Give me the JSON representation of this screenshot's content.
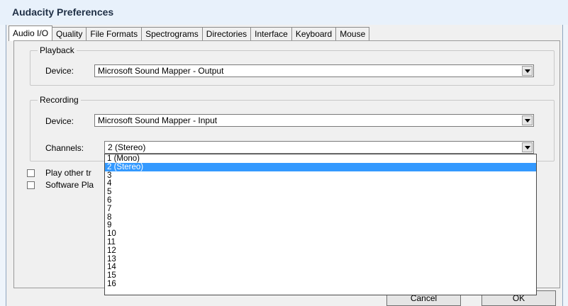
{
  "window": {
    "title": "Audacity Preferences"
  },
  "tabs": [
    {
      "label": "Audio I/O",
      "active": true
    },
    {
      "label": "Quality"
    },
    {
      "label": "File Formats"
    },
    {
      "label": "Spectrograms"
    },
    {
      "label": "Directories"
    },
    {
      "label": "Interface"
    },
    {
      "label": "Keyboard"
    },
    {
      "label": "Mouse"
    }
  ],
  "playback": {
    "legend": "Playback",
    "device_label": "Device:",
    "device_value": "Microsoft Sound Mapper - Output"
  },
  "recording": {
    "legend": "Recording",
    "device_label": "Device:",
    "device_value": "Microsoft Sound Mapper - Input",
    "channels_label": "Channels:",
    "channels_value": "2 (Stereo)"
  },
  "checkboxes": [
    {
      "label": "Play other tr",
      "checked": false
    },
    {
      "label": "Software Pla",
      "checked": false
    }
  ],
  "channels_dropdown": {
    "options": [
      "1 (Mono)",
      "2 (Stereo)",
      "3",
      "4",
      "5",
      "6",
      "7",
      "8",
      "9",
      "10",
      "11",
      "12",
      "13",
      "14",
      "15",
      "16"
    ],
    "selected_index": 1
  },
  "buttons": {
    "cancel": "Cancel",
    "ok": "OK"
  },
  "icons": {
    "combo_arrow": "chevron-down-icon"
  }
}
